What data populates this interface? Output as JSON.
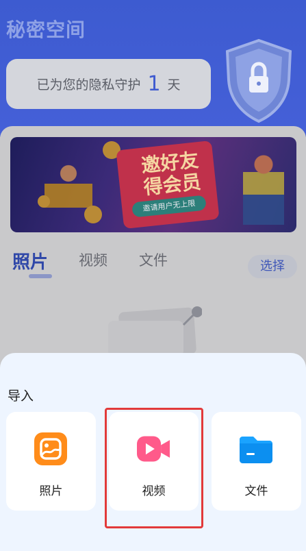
{
  "app_title": "秘密空间",
  "protect": {
    "prefix": "已为您的隐私守护",
    "days": "1",
    "suffix": "天"
  },
  "banner": {
    "title_line1": "邀好友",
    "title_line2": "得会员",
    "subtitle": "邀请用户无上限"
  },
  "tabs": [
    {
      "label": "照片",
      "active": true
    },
    {
      "label": "视频",
      "active": false
    },
    {
      "label": "文件",
      "active": false
    }
  ],
  "select_label": "选择",
  "import_sheet": {
    "title": "导入",
    "options": [
      {
        "label": "照片",
        "icon": "photo-gallery-icon",
        "color": "#ff8c1a"
      },
      {
        "label": "视频",
        "icon": "video-camera-icon",
        "color": "#ff5a8a"
      },
      {
        "label": "文件",
        "icon": "folder-icon",
        "color": "#1aa3ff"
      }
    ]
  },
  "colors": {
    "header_blue": "#4560d8",
    "accent_blue": "#3f5bd0",
    "highlight_red": "#e23a3a",
    "sheet_bg": "#eef5ff"
  }
}
